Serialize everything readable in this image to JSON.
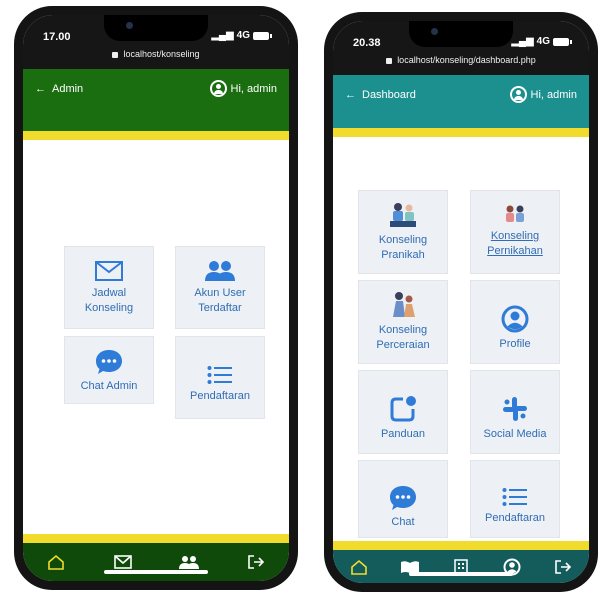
{
  "colors": {
    "admin_appbar": "#1a6e10",
    "admin_nav": "#0f4a0b",
    "dashboard_appbar": "#1c8f8f",
    "dashboard_nav": "#145c5c",
    "accent_yellow": "#f1dc2d",
    "card_bg": "#edf0f4",
    "card_text": "#2f6db5",
    "icon_blue": "#2f7bd8"
  },
  "admin_phone": {
    "status_time": "17.00",
    "signal": "4G",
    "url": "localhost/konseling",
    "appbar": {
      "back_label": "Admin",
      "greeting": "Hi, admin"
    },
    "menu": [
      {
        "line1": "Jadwal",
        "line2": "Konseling",
        "icon": "envelope-icon"
      },
      {
        "line1": "Akun User",
        "line2": "Terdaftar",
        "icon": "users-icon"
      },
      {
        "line1": "Chat Admin",
        "line2": "",
        "icon": "chat-bubble-icon"
      },
      {
        "line1": "Pendaftaran",
        "line2": "",
        "icon": "list-icon"
      }
    ],
    "bottom_nav": [
      "home-icon",
      "envelope-icon",
      "users-icon",
      "logout-icon"
    ]
  },
  "dashboard_phone": {
    "status_time": "20.38",
    "signal": "4G",
    "url": "localhost/konseling/dashboard.php",
    "appbar": {
      "back_label": "Dashboard",
      "greeting": "Hi, admin"
    },
    "menu": [
      {
        "line1": "Konseling",
        "line2": "Pranikah",
        "icon": "pranikah-illustration-icon"
      },
      {
        "line1": "Konseling",
        "line2": "Pernikahan",
        "icon": "couple-illustration-icon"
      },
      {
        "line1": "Konseling",
        "line2": "Perceraian",
        "icon": "separation-illustration-icon"
      },
      {
        "line1": "Profile",
        "line2": "",
        "icon": "profile-icon"
      },
      {
        "line1": "Panduan",
        "line2": "",
        "icon": "notification-square-icon"
      },
      {
        "line1": "Social Media",
        "line2": "",
        "icon": "slack-icon"
      },
      {
        "line1": "Chat",
        "line2": "",
        "icon": "chat-bubble-icon"
      },
      {
        "line1": "Pendaftaran",
        "line2": "",
        "icon": "list-icon"
      }
    ],
    "bottom_nav": [
      "home-icon",
      "book-icon",
      "building-icon",
      "profile-icon",
      "logout-icon"
    ]
  }
}
